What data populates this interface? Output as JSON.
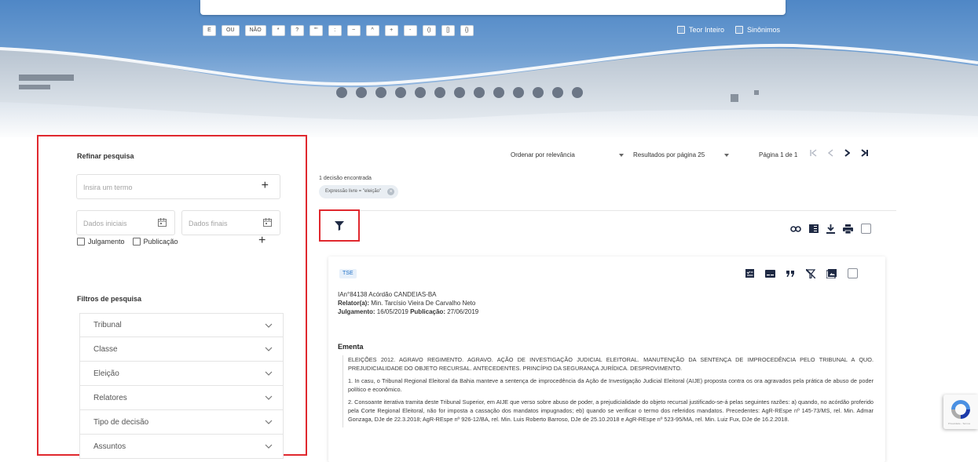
{
  "search": {
    "operators": [
      "E",
      "OU",
      "NÃO",
      "*",
      "?",
      "\"\"",
      ":",
      "~",
      "^",
      "+",
      "-",
      "()",
      "[]",
      "{}"
    ],
    "options": [
      "Teor Inteiro",
      "Sinônimos"
    ]
  },
  "sidebar": {
    "refine_title": "Refinar pesquisa",
    "term_placeholder": "Insira um termo",
    "term_add": "+",
    "date_start_placeholder": "Dados iniciais",
    "date_end_placeholder": "Dados finais",
    "date_types": [
      "Julgamento",
      "Publicação"
    ],
    "date_add": "+",
    "filters_title": "Filtros de pesquisa",
    "filters": [
      "Tribunal",
      "Classe",
      "Eleição",
      "Relatores",
      "Tipo de decisão",
      "Assuntos"
    ]
  },
  "results": {
    "sort_label": "Ordenar por relevância",
    "per_page_label": "Resultados por página 25",
    "page_info": "Página 1 de 1",
    "found": "1 decisão encontrada",
    "chip": "Expressão livre = \"eleição\"",
    "chip_close": "×"
  },
  "card": {
    "court": "TSE",
    "head": "IAn°84138 Acórdão CANDEIAS-BA",
    "relator_label": "Relator(a):",
    "relator": "Min. Tarcísio Vieira De Carvalho Neto",
    "julgamento_label": "Julgamento:",
    "julgamento": "16/05/2019",
    "publicacao_label": "Publicação:",
    "publicacao": "27/06/2019",
    "ementa_title": "Ementa",
    "paragraphs": [
      "ELEIÇÕES 2012. AGRAVO REGIMENTO. AGRAVO. AÇÃO DE INVESTIGAÇÃO JUDICIAL ELEITORAL. MANUTENÇÃO DA SENTENÇA DE IMPROCEDÊNCIA PELO TRIBUNAL A QUO. PREJUDICIALIDADE DO OBJETO RECURSAL. ANTECEDENTES. PRINCÍPIO DA SEGURANÇA JURÍDICA. DESPROVIMENTO.",
      "1. In casu, o Tribunal Regional Eleitoral da Bahia manteve a sentença de improcedência da Ação de Investigação Judicial Eleitoral (AIJE) proposta contra os ora agravados pela prática de abuso de poder político e econômico.",
      "2. Consoante iterativa tramita deste Tribunal Superior, em AIJE que verso sobre abuso de poder, a prejudicialidade do objeto recursal justificado-se-á pelas seguintes razões: a) quando, no acórdão proferido pela Corte Regional Eleitoral, não for imposta a cassação dos mandatos impugnados; eb) quando se verificar o termo dos referidos mandatos. Precedentes: AgR-REspe nº 145-73/MS, rel. Min. Admar Gonzaga, DJe de 22.3.2018; AgR-REspe nº 926-12/BA, rel. Min. Luis Roberto Barroso, DJe de 25.10.2018 e AgR-REspe nº 523-95/MA, rel. Min. Luiz Fux, DJe de 16.2.2018."
    ]
  },
  "recaptcha": {
    "label": "Privacidade - Termos"
  },
  "colors": {
    "highlight": "#e0282e",
    "link_blue": "#1e6fc6",
    "navy": "#1f2a44"
  }
}
